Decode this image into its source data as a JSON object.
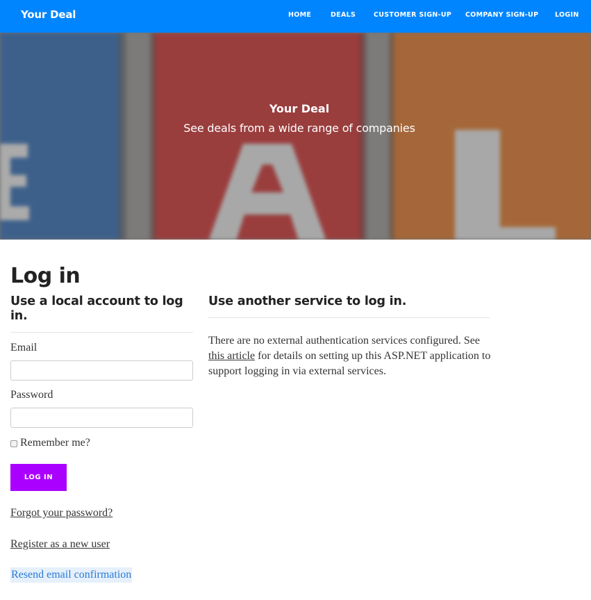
{
  "navbar": {
    "brand": "Your Deal",
    "links": [
      "HOME",
      "DEALS",
      "CUSTOMER SIGN-UP",
      "COMPANY SIGN-UP",
      "LOGIN"
    ],
    "background_color": "#0085ff"
  },
  "hero": {
    "title": "Your Deal",
    "subtitle": "See deals from a wide range of companies",
    "colors": [
      "#3a6fb0",
      "#c83a3a",
      "#d97a33"
    ]
  },
  "main": {
    "page_title": "Log in",
    "local_heading": "Use a local account to log in.",
    "email_label": "Email",
    "email_value": "",
    "password_label": "Password",
    "password_value": "",
    "remember_label": "Remember me?",
    "login_button": "LOG IN",
    "login_button_color": "#aa00ff",
    "forgot_link": "Forgot your password?",
    "register_link": "Register as a new user",
    "resend_link": "Resend email confirmation"
  },
  "external": {
    "heading": "Use another service to log in.",
    "text_before": "There are no external authentication services configured. See ",
    "article_link": "this article",
    "text_after": " for details on setting up this ASP.NET application to support logging in via external services."
  }
}
